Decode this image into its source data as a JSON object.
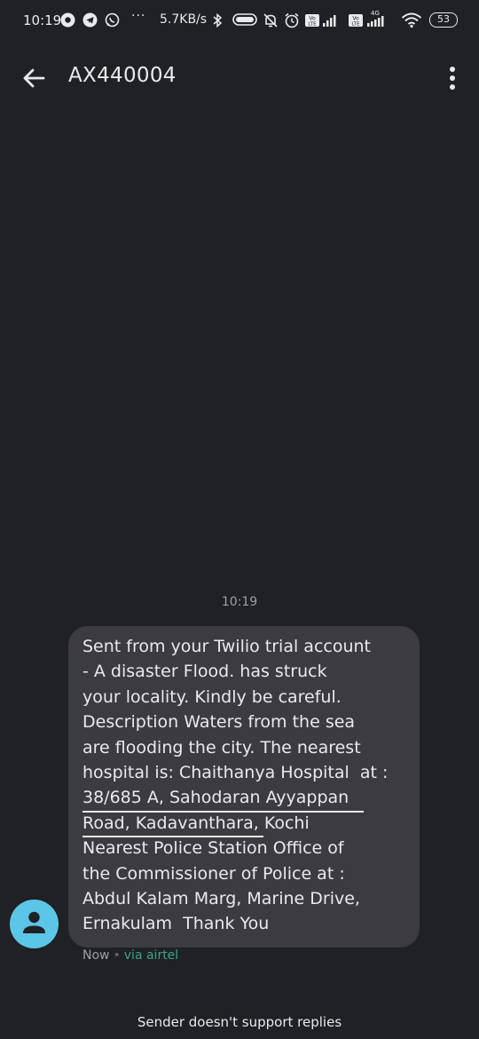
{
  "status_bar": {
    "time": "10:19",
    "dots": "···",
    "network_speed": "5.7KB/s",
    "sim1_label": "Vo LTE",
    "sim2_label": "Vo LTE",
    "network_type": "4G",
    "battery_level": "53"
  },
  "header": {
    "title": "AX440004",
    "back_icon": "arrow-left-icon",
    "more_icon": "more-vertical-icon"
  },
  "conversation": {
    "timestamp": "10:19",
    "message": {
      "text": "Sent from your Twilio trial account\n- A disaster Flood. has struck\nyour locality. Kindly be careful.\nDescription Waters from the sea\nare flooding the city. The nearest\nhospital is: Chaithanya Hospital  at :\n38/685 A, Sahodaran Ayyappan\nRoad, Kadavanthara, Kochi\nNearest Police Station Office of\nthe Commissioner of Police at :\nAbdul Kalam Marg, Marine Drive,\nErnakulam  Thank You",
      "time": "Now",
      "separator": "•",
      "carrier": "via airtel"
    },
    "avatar_icon": "person-icon"
  },
  "footer": {
    "note": "Sender doesn't support replies"
  },
  "colors": {
    "background": "#202124",
    "bubble": "#3c3c40",
    "avatar": "#5bc6e7",
    "carrier_text": "#3ea386"
  }
}
